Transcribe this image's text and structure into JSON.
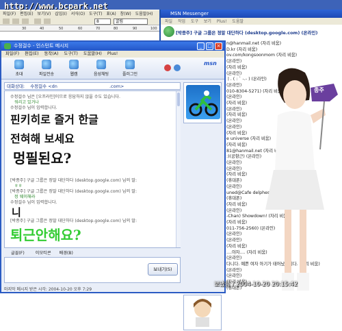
{
  "watermark": "http://www.bcpark.net",
  "bg_menu": [
    "파일(F)",
    "편집(E)",
    "보기(V)",
    "삽입(I)",
    "서식(O)",
    "도구(T)",
    "표(A)",
    "창(W)",
    "도움말(H)"
  ],
  "font_size": "8",
  "font_name": "굴림",
  "ruler": [
    "10",
    "20",
    "30",
    "40",
    "50",
    "60",
    "70",
    "80",
    "90",
    "100"
  ],
  "msn_main": {
    "title": "MSN Messenger",
    "menu": [
      "파일",
      "작업",
      "도구",
      "보기",
      "Plus!",
      "도움말"
    ],
    "status_text": "[박종주] 구글 그룹은 정말 대단하다 (desktop.google.com) (온라인)",
    "contacts": [
      "n@hanmail.net (자리 비움)",
      "D.kr (자리 비움)",
      "ov.com/kongsoonmom (자리 비움)",
      "(온라인)",
      "(자리 비움)",
      "(온라인)",
      "ㅣ. ( : ` -.- ) (온라인)",
      "(온라인)",
      "010-8304-5271) (자리 비움)",
      "(온라인)",
      "(자리 비움)",
      "(온라인)",
      "(자리 비움)",
      "(온라인)",
      "(온라인)",
      "(자리 비움)",
      "e universe (자리 비움)",
      "(자리 비움)",
      "81@hanmail.net (자리 비움)",
      ":)(공항근) (온라인)",
      "(온라인)",
      "(온라인)",
      "(자리 비움)",
      "(휴대폰)",
      "(온라인)",
      "uned@Cafe delphes (온라인)",
      "(휴대폰)",
      "(자리 비움)",
      "(온라인)",
      "-Chan) Showdown! (자리 비움)",
      "(자리 비움)",
      "011-756-2560) (온라인)",
      "(온라인)",
      "(온라인)",
      "(자리 비움)",
      "....야자.... (자리 비움)",
      "(온라인)",
      "다니다. 예쁜 여자 아기가 태어났습니다. (자리 비움)",
      "(온라인)",
      "(온라인)",
      "(자리 비움)",
      "(휴대폰)"
    ]
  },
  "conv": {
    "title": "수정걸수 - 인스턴트 메시지",
    "menu": [
      "파일(F)",
      "편집(E)",
      "동작(A)",
      "도구(T)",
      "도움말(H)",
      "Plus!"
    ],
    "toolbar": [
      "초대",
      "파일전송",
      "웹캠",
      "음성채팅",
      "플러그인"
    ],
    "msn_logo": "msn",
    "to_label": "대화상대:",
    "to_value": "수정걸수 <dn",
    "to_value2": ".com>",
    "transcript": [
      "수정걸수 님은 [오프라인]이므로 응답하지 않을 수도 있습니다.",
      "워리고 있거나",
      "수정걸수 님이 입력합니다.",
      "[박종주] 구글 그룹은 정말 대단하다 (desktop.google.com) 님의 말:",
      "ㅎㅎ",
      "[박종주] 구글 그룹은 정말 대단하다 (desktop.google.com) 님의 말:",
      "정 웨이해라",
      "수정걸수 님이 입력합니다.",
      "[박종주] 구글 그룹은 정말 대단하다 (desktop.google.com) 님의 말:"
    ],
    "handwriting": [
      "핀키히로 즐거 한글",
      "전혀해 보세요",
      "멍필된요?",
      "니",
      "퇴근안해요?"
    ],
    "format_labels": [
      "글꼴(F)",
      "이모티콘",
      "배경(B)"
    ],
    "send_label": "보내기(S)",
    "status": "마지막 메시지 받은 시각: 2004-10-20 오후 7:29"
  },
  "sign_text": "종주",
  "footer": "보냈음 / 2004-10-20 20:15:42",
  "colors": {
    "title_blue": "#2456c7",
    "accent_purple": "#6a3f9e",
    "green_text": "#33cc33"
  }
}
